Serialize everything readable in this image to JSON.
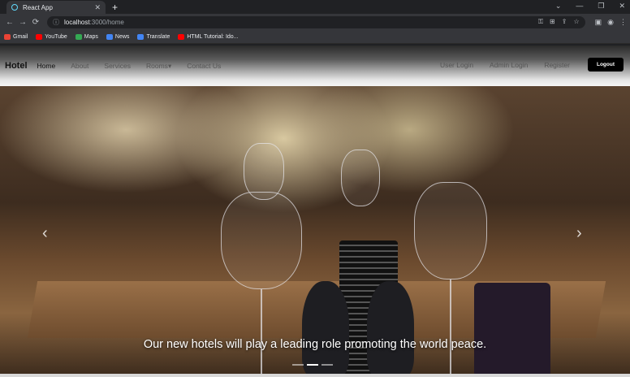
{
  "browser": {
    "tab_title": "React App",
    "tab_close": "✕",
    "new_tab": "+",
    "url_host": "localhost",
    "url_path": ":3000/home",
    "back": "←",
    "forward": "→",
    "reload": "⟳"
  },
  "bookmarks": [
    {
      "label": "Gmail",
      "color": "#ea4335"
    },
    {
      "label": "YouTube",
      "color": "#ff0000"
    },
    {
      "label": "Maps",
      "color": "#34a853"
    },
    {
      "label": "News",
      "color": "#4285f4"
    },
    {
      "label": "Translate",
      "color": "#4285f4"
    },
    {
      "label": "HTML Tutorial: Ido...",
      "color": "#ff0000"
    }
  ],
  "navbar": {
    "brand": "Hotel",
    "links": [
      "Home",
      "About",
      "Services",
      "Rooms",
      "Contact Us"
    ],
    "rooms_caret": "▾",
    "right_links": [
      "User Login",
      "Admin Login",
      "Register"
    ],
    "logout": "Logout"
  },
  "carousel": {
    "caption": "Our new hotels will play a leading role promoting the world peace.",
    "prev": "‹",
    "next": "›",
    "slide_count": 3,
    "active_index": 1
  }
}
